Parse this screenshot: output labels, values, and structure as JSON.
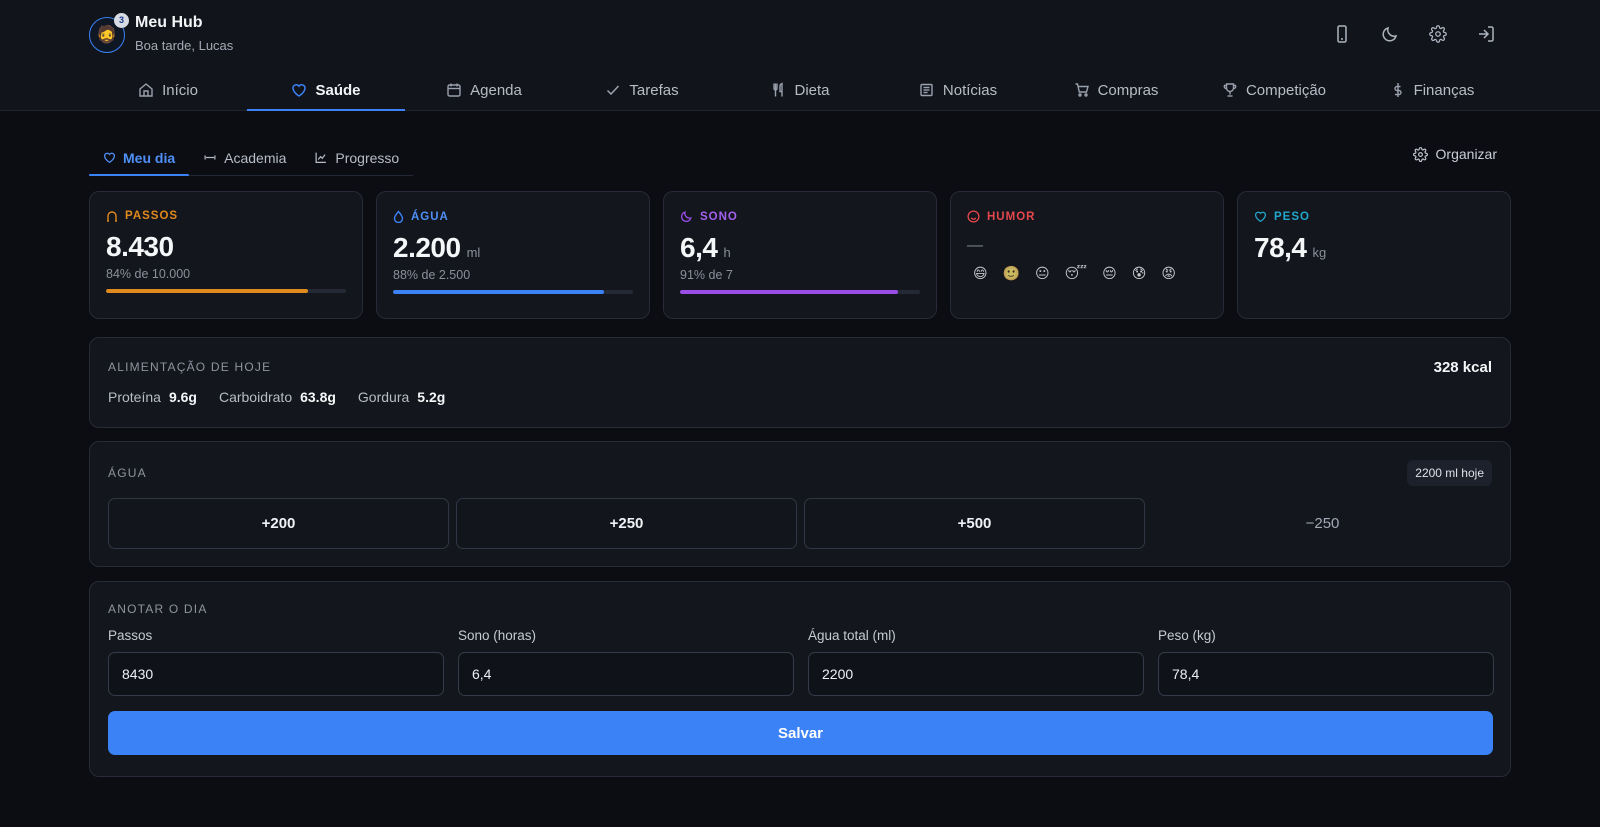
{
  "app": {
    "title": "Meu Hub",
    "greeting": "Boa tarde, Lucas",
    "avatar_emoji": "🧔",
    "avatar_badge": "3"
  },
  "header_actions": [
    {
      "name": "phone-icon"
    },
    {
      "name": "moon-icon"
    },
    {
      "name": "gear-icon"
    },
    {
      "name": "logout-icon"
    }
  ],
  "nav": [
    {
      "label": "Início",
      "icon": "home-icon"
    },
    {
      "label": "Saúde",
      "icon": "heart-icon",
      "active": true
    },
    {
      "label": "Agenda",
      "icon": "calendar-icon"
    },
    {
      "label": "Tarefas",
      "icon": "check-icon"
    },
    {
      "label": "Dieta",
      "icon": "utensils-icon"
    },
    {
      "label": "Notícias",
      "icon": "newspaper-icon"
    },
    {
      "label": "Compras",
      "icon": "cart-icon"
    },
    {
      "label": "Competição",
      "icon": "trophy-icon"
    },
    {
      "label": "Finanças",
      "icon": "dollar-icon"
    }
  ],
  "subtabs": [
    {
      "label": "Meu dia",
      "icon": "heart-icon",
      "active": true
    },
    {
      "label": "Academia",
      "icon": "dumbbell-icon"
    },
    {
      "label": "Progresso",
      "icon": "chart-line-icon"
    }
  ],
  "organize_label": "Organizar",
  "metrics": {
    "steps": {
      "label": "PASSOS",
      "value": "8.430",
      "goal_text": "84% de 10.000",
      "progress": 0.84,
      "color": "#e08a1e"
    },
    "water": {
      "label": "ÁGUA",
      "value": "2.200",
      "unit": "ml",
      "goal_text": "88% de 2.500",
      "progress": 0.88,
      "color": "#3b82f6"
    },
    "sleep": {
      "label": "SONO",
      "value": "6,4",
      "unit": "h",
      "goal_text": "91% de 7",
      "progress": 0.91,
      "color": "#9b4de8"
    },
    "mood": {
      "label": "HUMOR",
      "value": "—",
      "color": "#e5484d",
      "options": [
        "😄",
        "🙂",
        "😐",
        "😴",
        "😔",
        "😰",
        "😡"
      ]
    },
    "weight": {
      "label": "PESO",
      "value": "78,4",
      "unit": "kg",
      "color": "#22a6c9"
    }
  },
  "food": {
    "title": "ALIMENTAÇÃO DE HOJE",
    "kcal": "328 kcal",
    "protein_label": "Proteína",
    "protein": "9.6g",
    "carb_label": "Carboidrato",
    "carb": "63.8g",
    "fat_label": "Gordura",
    "fat": "5.2g"
  },
  "water_section": {
    "title": "ÁGUA",
    "badge": "2200 ml hoje",
    "buttons": [
      "+200",
      "+250",
      "+500",
      "−250"
    ]
  },
  "log": {
    "title": "ANOTAR O DIA",
    "fields": [
      {
        "label": "Passos",
        "value": "8430"
      },
      {
        "label": "Sono (horas)",
        "value": "6,4"
      },
      {
        "label": "Água total (ml)",
        "value": "2200"
      },
      {
        "label": "Peso (kg)",
        "value": "78,4"
      }
    ],
    "save_label": "Salvar"
  }
}
